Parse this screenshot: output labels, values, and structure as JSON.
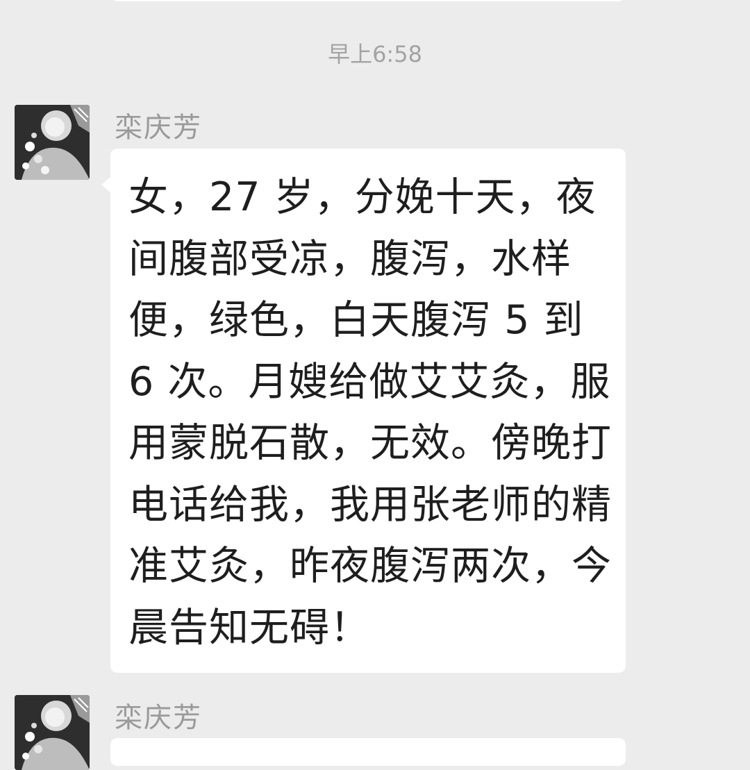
{
  "chat": {
    "timestamp": "早上6:58",
    "messages": [
      {
        "sender": "栾庆芳",
        "avatar_icon": "user-avatar-photo",
        "text": "女，27 岁，分娩十天，夜间腹部受凉，腹泻，水样便，绿色，白天腹泻 5 到 6 次。月嫂给做艾艾灸，服用蒙脱石散，无效。傍晚打电话给我，我用张老师的精准艾灸，昨夜腹泻两次，今晨告知无碍！"
      },
      {
        "sender": "栾庆芳",
        "avatar_icon": "user-avatar-photo",
        "text": ""
      }
    ]
  },
  "colors": {
    "background": "#ececec",
    "bubble": "#ffffff",
    "text": "#1e1e1e",
    "muted": "#9a9a9a"
  }
}
